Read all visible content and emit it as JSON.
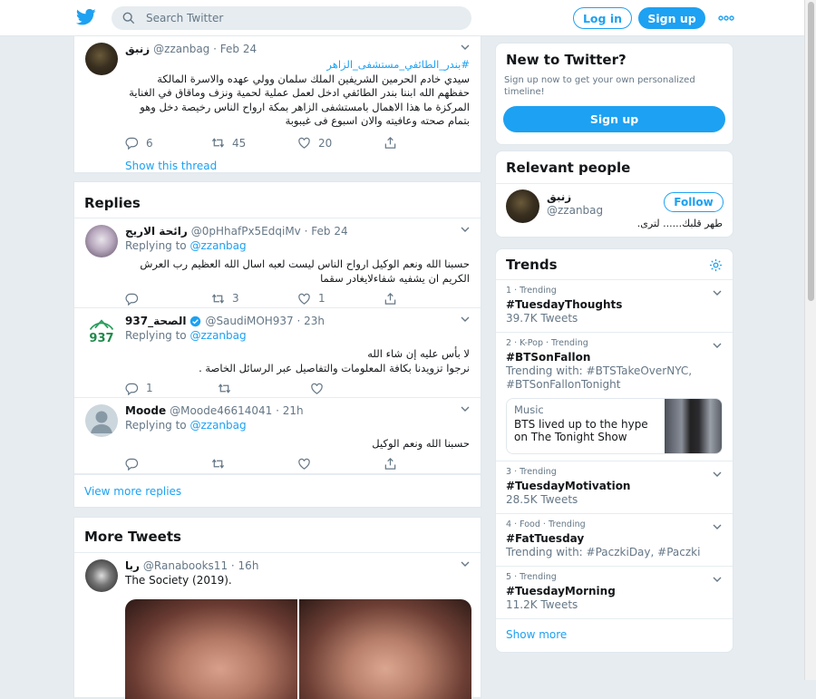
{
  "search": {
    "placeholder": "Search Twitter"
  },
  "header": {
    "login": "Log in",
    "signup": "Sign up"
  },
  "main_tweet": {
    "name": "زنبق",
    "handle": "@zzanbag",
    "date": "· Feb 24",
    "hashtag": "#بندر_الطائفي_مستشفى_الزاهر",
    "lines": [
      "سيدي خادم الحرمين الشريفين الملك سلمان وولي عهده والاسرة المالكة",
      "حفظهم الله ابننا بندر الطائفي ادخل لعمل عملية لحمية ونزف وماقاق في الغناية",
      "المركزة ما هذا الاهمال بامستشفى الزاهر بمكة ارواح الناس رخيصة دخل وهو",
      "بتمام صحته وعافيته والان اسبوع فى غيبوبة"
    ],
    "replies": "6",
    "retweets": "45",
    "likes": "20",
    "thread_link": "Show this thread"
  },
  "replies_title": "Replies",
  "replies": [
    {
      "name": "رائحة الاريج",
      "handle": "@0pHhafPx5EdqiMv",
      "date": "· Feb 24",
      "replying_prefix": "Replying to",
      "replying_to": "@zzanbag",
      "lines": [
        "حسبنا الله ونعم الوكيل ارواح الناس ليست لعبه اسال الله العظيم رب العرش",
        "الكريم ان يشفيه شفاءلايغادر سقما"
      ],
      "replies": "",
      "retweets": "3",
      "likes": "1"
    },
    {
      "name": "الصحة_937",
      "handle": "@SaudiMOH937",
      "date": "· 23h",
      "replying_prefix": "Replying to",
      "replying_to": "@zzanbag",
      "lines": [
        "لا بأس عليه إن شاء الله",
        "نرجوا تزويدنا بكافة المعلومات والتفاصيل عبر الرسائل الخاصة ."
      ],
      "replies": "1",
      "retweets": "",
      "likes": "",
      "avatar_text": "937"
    },
    {
      "name": "Moode",
      "handle": "@Moode46614041",
      "date": "· 21h",
      "replying_prefix": "Replying to",
      "replying_to": "@zzanbag",
      "lines": [
        "حسبنا الله ونعم الوكيل"
      ],
      "replies": "",
      "retweets": "",
      "likes": ""
    }
  ],
  "view_more_replies": "View more replies",
  "more_tweets_title": "More Tweets",
  "more_tweet": {
    "name": "ربا",
    "handle": "@Ranabooks11",
    "date": "· 16h",
    "text": "The Society (2019)."
  },
  "new_to_twitter": {
    "title": "New to Twitter?",
    "desc": "Sign up now to get your own personalized timeline!",
    "button": "Sign up"
  },
  "relevant": {
    "title": "Relevant people",
    "name": "زنبق",
    "handle": "@zzanbag",
    "follow": "Follow",
    "bio": "طهر قلبك...... لترى."
  },
  "trends": {
    "title": "Trends",
    "items": [
      {
        "meta": "1 · Trending",
        "name": "#TuesdayThoughts",
        "sub": "39.7K Tweets"
      },
      {
        "meta": "2 · K-Pop · Trending",
        "name": "#BTSonFallon",
        "sub": "Trending with: #BTSTakeOverNYC, #BTSonFallonTonight",
        "card": {
          "label": "Music",
          "text": "BTS lived up to the hype on The Tonight Show"
        }
      },
      {
        "meta": "3 · Trending",
        "name": "#TuesdayMotivation",
        "sub": "28.5K Tweets"
      },
      {
        "meta": "4 · Food · Trending",
        "name": "#FatTuesday",
        "sub": "Trending with: #PaczkiDay, #Paczki"
      },
      {
        "meta": "5 · Trending",
        "name": "#TuesdayMorning",
        "sub": "11.2K Tweets"
      }
    ],
    "show_more": "Show more"
  },
  "colors": {
    "accent": "#1da1f2",
    "background": "#e6ecf0",
    "muted": "#657786"
  }
}
